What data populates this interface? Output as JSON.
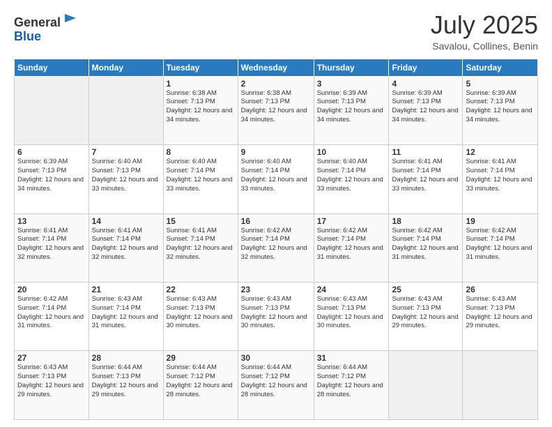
{
  "logo": {
    "general": "General",
    "blue": "Blue"
  },
  "title": {
    "month_year": "July 2025",
    "location": "Savalou, Collines, Benin"
  },
  "days_of_week": [
    "Sunday",
    "Monday",
    "Tuesday",
    "Wednesday",
    "Thursday",
    "Friday",
    "Saturday"
  ],
  "weeks": [
    [
      {
        "day": "",
        "info": ""
      },
      {
        "day": "",
        "info": ""
      },
      {
        "day": "1",
        "info": "Sunrise: 6:38 AM\nSunset: 7:13 PM\nDaylight: 12 hours and 34 minutes."
      },
      {
        "day": "2",
        "info": "Sunrise: 6:38 AM\nSunset: 7:13 PM\nDaylight: 12 hours and 34 minutes."
      },
      {
        "day": "3",
        "info": "Sunrise: 6:39 AM\nSunset: 7:13 PM\nDaylight: 12 hours and 34 minutes."
      },
      {
        "day": "4",
        "info": "Sunrise: 6:39 AM\nSunset: 7:13 PM\nDaylight: 12 hours and 34 minutes."
      },
      {
        "day": "5",
        "info": "Sunrise: 6:39 AM\nSunset: 7:13 PM\nDaylight: 12 hours and 34 minutes."
      }
    ],
    [
      {
        "day": "6",
        "info": "Sunrise: 6:39 AM\nSunset: 7:13 PM\nDaylight: 12 hours and 34 minutes."
      },
      {
        "day": "7",
        "info": "Sunrise: 6:40 AM\nSunset: 7:13 PM\nDaylight: 12 hours and 33 minutes."
      },
      {
        "day": "8",
        "info": "Sunrise: 6:40 AM\nSunset: 7:14 PM\nDaylight: 12 hours and 33 minutes."
      },
      {
        "day": "9",
        "info": "Sunrise: 6:40 AM\nSunset: 7:14 PM\nDaylight: 12 hours and 33 minutes."
      },
      {
        "day": "10",
        "info": "Sunrise: 6:40 AM\nSunset: 7:14 PM\nDaylight: 12 hours and 33 minutes."
      },
      {
        "day": "11",
        "info": "Sunrise: 6:41 AM\nSunset: 7:14 PM\nDaylight: 12 hours and 33 minutes."
      },
      {
        "day": "12",
        "info": "Sunrise: 6:41 AM\nSunset: 7:14 PM\nDaylight: 12 hours and 33 minutes."
      }
    ],
    [
      {
        "day": "13",
        "info": "Sunrise: 6:41 AM\nSunset: 7:14 PM\nDaylight: 12 hours and 32 minutes."
      },
      {
        "day": "14",
        "info": "Sunrise: 6:41 AM\nSunset: 7:14 PM\nDaylight: 12 hours and 32 minutes."
      },
      {
        "day": "15",
        "info": "Sunrise: 6:41 AM\nSunset: 7:14 PM\nDaylight: 12 hours and 32 minutes."
      },
      {
        "day": "16",
        "info": "Sunrise: 6:42 AM\nSunset: 7:14 PM\nDaylight: 12 hours and 32 minutes."
      },
      {
        "day": "17",
        "info": "Sunrise: 6:42 AM\nSunset: 7:14 PM\nDaylight: 12 hours and 31 minutes."
      },
      {
        "day": "18",
        "info": "Sunrise: 6:42 AM\nSunset: 7:14 PM\nDaylight: 12 hours and 31 minutes."
      },
      {
        "day": "19",
        "info": "Sunrise: 6:42 AM\nSunset: 7:14 PM\nDaylight: 12 hours and 31 minutes."
      }
    ],
    [
      {
        "day": "20",
        "info": "Sunrise: 6:42 AM\nSunset: 7:14 PM\nDaylight: 12 hours and 31 minutes."
      },
      {
        "day": "21",
        "info": "Sunrise: 6:43 AM\nSunset: 7:14 PM\nDaylight: 12 hours and 31 minutes."
      },
      {
        "day": "22",
        "info": "Sunrise: 6:43 AM\nSunset: 7:13 PM\nDaylight: 12 hours and 30 minutes."
      },
      {
        "day": "23",
        "info": "Sunrise: 6:43 AM\nSunset: 7:13 PM\nDaylight: 12 hours and 30 minutes."
      },
      {
        "day": "24",
        "info": "Sunrise: 6:43 AM\nSunset: 7:13 PM\nDaylight: 12 hours and 30 minutes."
      },
      {
        "day": "25",
        "info": "Sunrise: 6:43 AM\nSunset: 7:13 PM\nDaylight: 12 hours and 29 minutes."
      },
      {
        "day": "26",
        "info": "Sunrise: 6:43 AM\nSunset: 7:13 PM\nDaylight: 12 hours and 29 minutes."
      }
    ],
    [
      {
        "day": "27",
        "info": "Sunrise: 6:43 AM\nSunset: 7:13 PM\nDaylight: 12 hours and 29 minutes."
      },
      {
        "day": "28",
        "info": "Sunrise: 6:44 AM\nSunset: 7:13 PM\nDaylight: 12 hours and 29 minutes."
      },
      {
        "day": "29",
        "info": "Sunrise: 6:44 AM\nSunset: 7:12 PM\nDaylight: 12 hours and 28 minutes."
      },
      {
        "day": "30",
        "info": "Sunrise: 6:44 AM\nSunset: 7:12 PM\nDaylight: 12 hours and 28 minutes."
      },
      {
        "day": "31",
        "info": "Sunrise: 6:44 AM\nSunset: 7:12 PM\nDaylight: 12 hours and 28 minutes."
      },
      {
        "day": "",
        "info": ""
      },
      {
        "day": "",
        "info": ""
      }
    ]
  ]
}
